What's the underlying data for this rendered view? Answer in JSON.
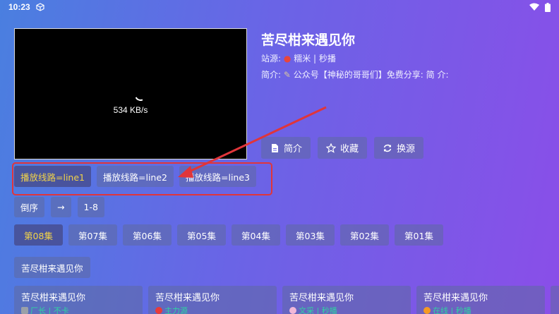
{
  "statusbar": {
    "time": "10:23"
  },
  "player": {
    "speed": "534 KB/s"
  },
  "detail": {
    "title": "苦尽柑来遇见你",
    "source_label": "站源:",
    "source_value": "糯米 | 秒播",
    "intro_label": "简介:",
    "intro_value": "公众号【神秘的哥哥们】免费分享: 简 介:"
  },
  "actions": [
    {
      "label": "简介",
      "icon": "document-icon"
    },
    {
      "label": "收藏",
      "icon": "star-icon"
    },
    {
      "label": "换源",
      "icon": "refresh-icon"
    }
  ],
  "lines": [
    {
      "label": "播放线路=line1",
      "active": true
    },
    {
      "label": "播放线路=line2",
      "active": false
    },
    {
      "label": "播放线路=line3",
      "active": false
    }
  ],
  "sort": {
    "reverse": "倒序",
    "arrow": "→",
    "range": "1-8"
  },
  "episodes": [
    {
      "label": "第08集",
      "active": true
    },
    {
      "label": "第07集",
      "active": false
    },
    {
      "label": "第06集",
      "active": false
    },
    {
      "label": "第05集",
      "active": false
    },
    {
      "label": "第04集",
      "active": false
    },
    {
      "label": "第03集",
      "active": false
    },
    {
      "label": "第02集",
      "active": false
    },
    {
      "label": "第01集",
      "active": false
    }
  ],
  "series": {
    "label": "苦尽柑来遇见你"
  },
  "results": [
    {
      "title": "苦尽柑来遇见你",
      "sub": "厂长 | 不卡",
      "icon_color": "#9aa0a8"
    },
    {
      "title": "苦尽柑来遇见你",
      "sub": "主力源",
      "icon_color": "#e83a3a"
    },
    {
      "title": "苦尽柑来遇见你",
      "sub": "文采 | 秒播",
      "icon_color": "#f1b8d8"
    },
    {
      "title": "苦尽柑来遇见你",
      "sub": "在线 | 秒播",
      "icon_color": "#f59a23"
    }
  ],
  "colors": {
    "accent_yellow": "#f2d348",
    "highlight_red": "#e0353a",
    "sub_green": "#2fd4a0"
  }
}
